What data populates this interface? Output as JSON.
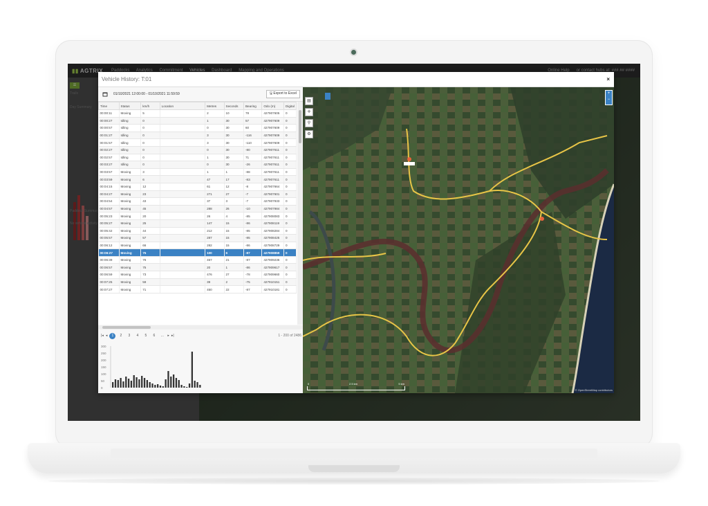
{
  "app": {
    "brand": "AGTRIX",
    "nav": [
      "Paddocks",
      "Analytics",
      "Commitment",
      "Vehicles",
      "Dashboard",
      "Mapping and Operations"
    ],
    "top_right": [
      "Online Help",
      "or contact hubs at: ### ## ####"
    ],
    "left_labels": [
      "Trails",
      "Day Summary",
      "Paddock Summary",
      "No vehicle activity"
    ]
  },
  "modal": {
    "title": "Vehicle History: T:01",
    "close": "×",
    "date_range": "01/10/2021 12:00:00 - 01/10/2021 11:59:59",
    "export_label": "Export to Excel"
  },
  "table": {
    "columns": [
      "Time",
      "Status",
      "km/h",
      "Location",
      "Metres",
      "Seconds",
      "Bearing",
      "Odo (m)",
      "Digital"
    ],
    "rows": [
      [
        "00:00:11",
        "Moving",
        "5",
        "",
        "2",
        "10",
        "78",
        "427907605",
        "0"
      ],
      [
        "00:00:27",
        "Idling",
        "0",
        "",
        "1",
        "30",
        "57",
        "427907609",
        "0"
      ],
      [
        "00:00:57",
        "Idling",
        "0",
        "",
        "0",
        "30",
        "60",
        "427907609",
        "0"
      ],
      [
        "00:01:27",
        "Idling",
        "0",
        "",
        "3",
        "30",
        "-116",
        "427907609",
        "0"
      ],
      [
        "00:01:57",
        "Idling",
        "0",
        "",
        "3",
        "30",
        "-110",
        "427907609",
        "0"
      ],
      [
        "00:02:27",
        "Idling",
        "0",
        "",
        "0",
        "30",
        "-80",
        "427907611",
        "0"
      ],
      [
        "00:02:57",
        "Idling",
        "0",
        "",
        "1",
        "30",
        "71",
        "427907611",
        "0"
      ],
      [
        "00:03:27",
        "Idling",
        "0",
        "",
        "0",
        "30",
        "-26",
        "427907611",
        "0"
      ],
      [
        "00:03:57",
        "Moving",
        "3",
        "",
        "1",
        "1",
        "-88",
        "427907611",
        "0"
      ],
      [
        "00:03:59",
        "Moving",
        "6",
        "",
        "47",
        "17",
        "-83",
        "427907611",
        "0"
      ],
      [
        "00:04:15",
        "Moving",
        "12",
        "",
        "61",
        "12",
        "-8",
        "427907664",
        "0"
      ],
      [
        "00:04:27",
        "Moving",
        "23",
        "",
        "271",
        "27",
        "-7",
        "427907601",
        "0"
      ],
      [
        "00:04:54",
        "Moving",
        "43",
        "",
        "37",
        "3",
        "-7",
        "427907933",
        "0"
      ],
      [
        "00:04:57",
        "Moving",
        "45",
        "",
        "288",
        "26",
        "-10",
        "427907984",
        "0"
      ],
      [
        "00:05:23",
        "Moving",
        "20",
        "",
        "26",
        "4",
        "-85",
        "427908083",
        "0"
      ],
      [
        "00:05:27",
        "Moving",
        "25",
        "",
        "147",
        "15",
        "-86",
        "427908119",
        "0"
      ],
      [
        "00:05:42",
        "Moving",
        "44",
        "",
        "212",
        "15",
        "-85",
        "427908284",
        "0"
      ],
      [
        "00:05:57",
        "Moving",
        "57",
        "",
        "287",
        "15",
        "-85",
        "427908425",
        "0"
      ],
      [
        "00:06:12",
        "Moving",
        "66",
        "",
        "282",
        "15",
        "-86",
        "427908729",
        "0"
      ],
      [
        "00:06:27",
        "Moving",
        "75",
        "",
        "100",
        "6",
        "-87",
        "427908859",
        "0"
      ],
      [
        "00:06:39",
        "Moving",
        "76",
        "",
        "467",
        "21",
        "-87",
        "427909236",
        "0"
      ],
      [
        "00:06:57",
        "Moving",
        "75",
        "",
        "20",
        "1",
        "-86",
        "427909617",
        "0"
      ],
      [
        "00:06:59",
        "Moving",
        "73",
        "",
        "476",
        "27",
        "-78",
        "427909660",
        "0"
      ],
      [
        "00:07:25",
        "Moving",
        "59",
        "",
        "39",
        "2",
        "-75",
        "427910151",
        "0"
      ],
      [
        "00:07:27",
        "Moving",
        "71",
        "",
        "450",
        "22",
        "-87",
        "427910181",
        "0"
      ]
    ],
    "selected_index": 19
  },
  "pager": {
    "pages": [
      "1",
      "2",
      "3",
      "4",
      "5",
      "6",
      "..."
    ],
    "active": "1",
    "count_text": "1 - 200 of 2486"
  },
  "mini_chart": {
    "y_ticks": [
      "300",
      "250",
      "200",
      "150",
      "100",
      "50",
      "0"
    ],
    "values": [
      40,
      60,
      55,
      70,
      45,
      80,
      65,
      50,
      90,
      75,
      60,
      85,
      70,
      55,
      40,
      30,
      20,
      25,
      15,
      10,
      60,
      120,
      80,
      95,
      70,
      55,
      20,
      10,
      5,
      30,
      260,
      50,
      40,
      20
    ]
  },
  "map": {
    "scale_labels": [
      "0",
      "2.5 km",
      "5 km"
    ],
    "attribution": "© OpenStreetMap contributors"
  },
  "colors": {
    "accent": "#3b82c4",
    "track": "#e8c547",
    "brand_green": "#9ac34a"
  }
}
